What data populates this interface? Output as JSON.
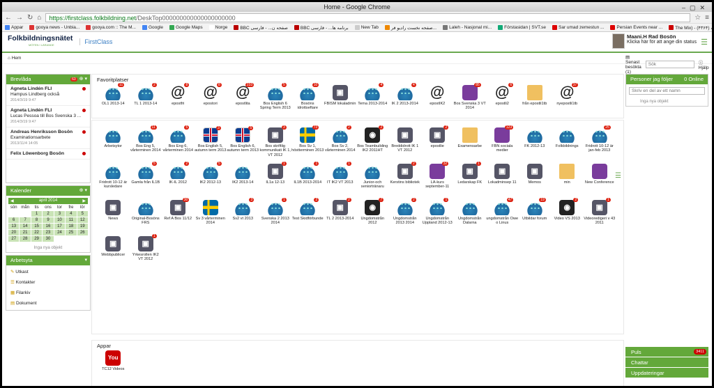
{
  "browser": {
    "title": "Home - Google Chrome",
    "url_host": "https://firstclass.folkbildning.net",
    "url_path": "/DeskTop000000000000000000000",
    "bookmarks": [
      "Appar",
      "gooya news - Unbia...",
      "gooya.com :: The M...",
      "Google",
      "Google Maps",
      "Norge",
      "BBC صفحه ن... - فارسی",
      "BBC برنامه ها... - فارسی",
      "New Tab",
      "صفحه نخست رادیو فر...",
      "Laleh - Nasjonal mi...",
      "Förstasidan | SVT.se",
      "Sar umad zemestun ...",
      "Persian Events near ...",
      "The Mix) - (۴۳۶۴) آيه"
    ],
    "bookmark_colors": [
      "#4285f4",
      "#d33",
      "#d33",
      "#4285f4",
      "#34a853",
      "#fff",
      "#b00",
      "#b00",
      "#ccc",
      "#e80",
      "#777",
      "#1a7",
      "#d00",
      "#d00",
      "#c00"
    ]
  },
  "header": {
    "logo": "Folkbildningsnätet",
    "logo_sub": "MÖTEN I LÄRANDE",
    "app": "FirstClass",
    "user_name": "Maani.H Rad Bosön",
    "user_status": "Klicka här för att ange din status"
  },
  "toolbar": {
    "home": "Hem",
    "recent": "Senast besökta (1)",
    "search_placeholder": "Sök",
    "help": "Hjälp"
  },
  "left": {
    "mail_title": "Brevlåda",
    "mail_badge": "63",
    "mails": [
      {
        "from": "Agneta Lindén FLI",
        "subject": "Hampus Lindberg också",
        "time": "2014/3/19 9:47"
      },
      {
        "from": "Agneta Lindén FLI",
        "subject": "Lucas Pessoa till Bos Svenska 3 ...",
        "time": "2014/3/19 9:47"
      },
      {
        "from": "Andreas Henriksson Bosön",
        "subject": "Examinationsarbete",
        "time": "2013/11/4 14:05"
      },
      {
        "from": "Felix Löwenborg Bosön",
        "subject": "",
        "time": ""
      }
    ],
    "cal_title": "Kalender",
    "cal_month": "april 2014",
    "cal_days": [
      "sön",
      "mån",
      "tis",
      "ons",
      "tor",
      "fre",
      "lör"
    ],
    "cal_dates": [
      "",
      "",
      "1",
      "2",
      "3",
      "4",
      "5",
      "6",
      "7",
      "8",
      "9",
      "10",
      "11",
      "12",
      "13",
      "14",
      "15",
      "16",
      "17",
      "18",
      "19",
      "20",
      "21",
      "22",
      "23",
      "24",
      "25",
      "26",
      "27",
      "28",
      "29",
      "30",
      "",
      "",
      ""
    ],
    "cal_empty": "Inga nya objekt",
    "ws_title": "Arbetsyta",
    "ws_items": [
      "Utkast",
      "Kontakter",
      "Filarkiv",
      "Dokument"
    ]
  },
  "favorites": {
    "title": "Favoritplatser",
    "items": [
      {
        "l": "OL1 2013-14",
        "i": "grp",
        "b": "11"
      },
      {
        "l": "TL 1 2013-14",
        "i": "grp",
        "b": "2"
      },
      {
        "l": "epostfri",
        "i": "at",
        "b": "8"
      },
      {
        "l": "epostori",
        "i": "at",
        "b": "8"
      },
      {
        "l": "epostlita",
        "i": "at",
        "b": "233"
      },
      {
        "l": "Bos English 6 Spring Term 2013",
        "i": "grp",
        "b": "5"
      },
      {
        "l": "Bosöns idrottseftare",
        "i": "grp",
        "b": "10"
      },
      {
        "l": "FBISM lokaladmin",
        "i": "sq",
        "b": ""
      },
      {
        "l": "Tema 2013-2014",
        "i": "grp",
        "b": "4"
      },
      {
        "l": "IK 2 2013-2014",
        "i": "grp",
        "b": "4"
      },
      {
        "l": "epostIK2",
        "i": "at",
        "b": ""
      },
      {
        "l": "Bos Svenska 3 VT 2014",
        "i": "pur",
        "b": "85"
      },
      {
        "l": "epostli2",
        "i": "at",
        "b": "6"
      },
      {
        "l": "från epostli1tb",
        "i": "fold",
        "b": ""
      },
      {
        "l": "nyepostli1tb",
        "i": "at",
        "b": "37"
      }
    ]
  },
  "desktop": {
    "items": [
      {
        "l": "Arbetsytor",
        "i": "grp",
        "b": ""
      },
      {
        "l": "Bos Eng 5, vårterminen 2014",
        "i": "grp",
        "b": "11"
      },
      {
        "l": "Bos Eng 6, vårterminen 2014",
        "i": "grp",
        "b": "5"
      },
      {
        "l": "Bos English 5, autumn term 2013",
        "i": "uk",
        "b": "3"
      },
      {
        "l": "Bos English 6, autumn term 2013",
        "i": "uk",
        "b": "5"
      },
      {
        "l": "Bos skriftlig kommunikati IK 1, VT 2012",
        "i": "sq",
        "b": "3"
      },
      {
        "l": "Bos Sv 1, höstterminen 2013",
        "i": "se",
        "b": "73"
      },
      {
        "l": "Bos Sv 2, vårterminen 2014",
        "i": "grp",
        "b": "2"
      },
      {
        "l": "Bos Teambuilding IK2 2011HT",
        "i": "bk",
        "b": "2"
      },
      {
        "l": "Breddidrott IK 1 VT 2012",
        "i": "sq",
        "b": ""
      },
      {
        "l": "epostlie",
        "i": "sq",
        "b": "2"
      },
      {
        "l": "Examensarbe",
        "i": "fold",
        "b": ""
      },
      {
        "l": "FBN sociala medier",
        "i": "pur",
        "b": "123"
      },
      {
        "l": "FK 2012-13",
        "i": "grp",
        "b": ""
      },
      {
        "l": "Folkbildnings",
        "i": "grp",
        "b": ""
      },
      {
        "l": "Fridrott 10-12 är jan-feb 2013",
        "i": "grp",
        "b": "25"
      },
      {
        "l": "Fridrott 10-12 är kursledare",
        "i": "grp",
        "b": ""
      },
      {
        "l": "Gamla från IL1B",
        "i": "grp",
        "b": "5"
      },
      {
        "l": "IK-IL 2012",
        "i": "grp",
        "b": "2"
      },
      {
        "l": "IK2 2012-13",
        "i": "grp",
        "b": "5"
      },
      {
        "l": "IK2 2013-14",
        "i": "grp",
        "b": ""
      },
      {
        "l": "IL1a 12-13",
        "i": "sq",
        "b": "1"
      },
      {
        "l": "IL1B 2013-2014",
        "i": "grp",
        "b": "1"
      },
      {
        "l": "IT IK2 VT 2013",
        "i": "grp",
        "b": "1"
      },
      {
        "l": "Junior-och seniortränaru",
        "i": "grp",
        "b": ""
      },
      {
        "l": "Kerstins bibliotek",
        "i": "sq",
        "b": "2"
      },
      {
        "l": "LA-kurs september-11",
        "i": "pur",
        "b": "32"
      },
      {
        "l": "Ledarskap FK",
        "i": "sq",
        "b": "1"
      },
      {
        "l": "Lokadminsep 11",
        "i": "sq",
        "b": ""
      },
      {
        "l": "Memos",
        "i": "sq",
        "b": ""
      },
      {
        "l": "min",
        "i": "fold",
        "b": ""
      },
      {
        "l": "New Conference",
        "i": "pur",
        "b": ""
      },
      {
        "l": "News",
        "i": "sq",
        "b": ""
      },
      {
        "l": "Original-Bosöns FRS",
        "i": "grp",
        "b": ""
      },
      {
        "l": "Ref A Bos 11/12",
        "i": "sq",
        "b": "30"
      },
      {
        "l": "Sv 3 vårterminen 2014",
        "i": "se",
        "b": ""
      },
      {
        "l": "Sv2 vt 2013",
        "i": "grp",
        "b": "3"
      },
      {
        "l": "Svenska 2 2013 2014",
        "i": "grp",
        "b": "1"
      },
      {
        "l": "Test Skidförbunde",
        "i": "grp",
        "b": "2"
      },
      {
        "l": "TL 2 2013-2014",
        "i": "sq",
        "b": "2"
      },
      {
        "l": "Ungdomstrån 2012",
        "i": "bk",
        "b": "7"
      },
      {
        "l": "Ungdomstrån 2013 2014",
        "i": "grp",
        "b": "2"
      },
      {
        "l": "Ungdomstrån Uppland 2012-13",
        "i": "grp",
        "b": "1"
      },
      {
        "l": "Ungdomstrån Dalarna",
        "i": "grp",
        "b": ""
      },
      {
        "l": "ungdomstrån Owe o Linus",
        "i": "grp",
        "b": "47"
      },
      {
        "l": "Utbildar forum",
        "i": "grp",
        "b": "19"
      },
      {
        "l": "Video VS 2013",
        "i": "bk",
        "b": "2"
      },
      {
        "l": "Videoredigeri v 43 2011",
        "i": "sq",
        "b": "1"
      },
      {
        "l": "Webbpublicer",
        "i": "sq",
        "b": ""
      },
      {
        "l": "Yrkesrollen IK2 VT 2012",
        "i": "sq",
        "b": "1"
      }
    ]
  },
  "apps": {
    "title": "Appar",
    "items": [
      {
        "l": "TC12 Videos",
        "i": "yt",
        "b": ""
      }
    ]
  },
  "right": {
    "people_title": "Personer jag följer",
    "online": "0 Online",
    "people_placeholder": "Skriv en del av ett namn",
    "people_empty": "Inga nya objekt",
    "bottom": [
      {
        "label": "Puls",
        "badge": "3411"
      },
      {
        "label": "Chattar",
        "badge": ""
      },
      {
        "label": "Uppdateringar",
        "badge": ""
      }
    ]
  }
}
